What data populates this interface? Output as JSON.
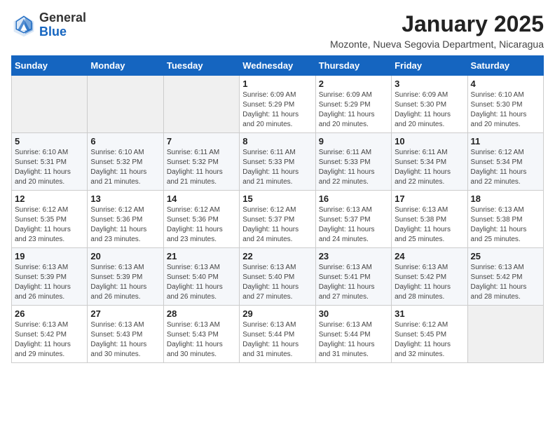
{
  "logo": {
    "general": "General",
    "blue": "Blue"
  },
  "header": {
    "title": "January 2025",
    "subtitle": "Mozonte, Nueva Segovia Department, Nicaragua"
  },
  "weekdays": [
    "Sunday",
    "Monday",
    "Tuesday",
    "Wednesday",
    "Thursday",
    "Friday",
    "Saturday"
  ],
  "weeks": [
    [
      {
        "day": "",
        "detail": ""
      },
      {
        "day": "",
        "detail": ""
      },
      {
        "day": "",
        "detail": ""
      },
      {
        "day": "1",
        "detail": "Sunrise: 6:09 AM\nSunset: 5:29 PM\nDaylight: 11 hours\nand 20 minutes."
      },
      {
        "day": "2",
        "detail": "Sunrise: 6:09 AM\nSunset: 5:29 PM\nDaylight: 11 hours\nand 20 minutes."
      },
      {
        "day": "3",
        "detail": "Sunrise: 6:09 AM\nSunset: 5:30 PM\nDaylight: 11 hours\nand 20 minutes."
      },
      {
        "day": "4",
        "detail": "Sunrise: 6:10 AM\nSunset: 5:30 PM\nDaylight: 11 hours\nand 20 minutes."
      }
    ],
    [
      {
        "day": "5",
        "detail": "Sunrise: 6:10 AM\nSunset: 5:31 PM\nDaylight: 11 hours\nand 20 minutes."
      },
      {
        "day": "6",
        "detail": "Sunrise: 6:10 AM\nSunset: 5:32 PM\nDaylight: 11 hours\nand 21 minutes."
      },
      {
        "day": "7",
        "detail": "Sunrise: 6:11 AM\nSunset: 5:32 PM\nDaylight: 11 hours\nand 21 minutes."
      },
      {
        "day": "8",
        "detail": "Sunrise: 6:11 AM\nSunset: 5:33 PM\nDaylight: 11 hours\nand 21 minutes."
      },
      {
        "day": "9",
        "detail": "Sunrise: 6:11 AM\nSunset: 5:33 PM\nDaylight: 11 hours\nand 22 minutes."
      },
      {
        "day": "10",
        "detail": "Sunrise: 6:11 AM\nSunset: 5:34 PM\nDaylight: 11 hours\nand 22 minutes."
      },
      {
        "day": "11",
        "detail": "Sunrise: 6:12 AM\nSunset: 5:34 PM\nDaylight: 11 hours\nand 22 minutes."
      }
    ],
    [
      {
        "day": "12",
        "detail": "Sunrise: 6:12 AM\nSunset: 5:35 PM\nDaylight: 11 hours\nand 23 minutes."
      },
      {
        "day": "13",
        "detail": "Sunrise: 6:12 AM\nSunset: 5:36 PM\nDaylight: 11 hours\nand 23 minutes."
      },
      {
        "day": "14",
        "detail": "Sunrise: 6:12 AM\nSunset: 5:36 PM\nDaylight: 11 hours\nand 23 minutes."
      },
      {
        "day": "15",
        "detail": "Sunrise: 6:12 AM\nSunset: 5:37 PM\nDaylight: 11 hours\nand 24 minutes."
      },
      {
        "day": "16",
        "detail": "Sunrise: 6:13 AM\nSunset: 5:37 PM\nDaylight: 11 hours\nand 24 minutes."
      },
      {
        "day": "17",
        "detail": "Sunrise: 6:13 AM\nSunset: 5:38 PM\nDaylight: 11 hours\nand 25 minutes."
      },
      {
        "day": "18",
        "detail": "Sunrise: 6:13 AM\nSunset: 5:38 PM\nDaylight: 11 hours\nand 25 minutes."
      }
    ],
    [
      {
        "day": "19",
        "detail": "Sunrise: 6:13 AM\nSunset: 5:39 PM\nDaylight: 11 hours\nand 26 minutes."
      },
      {
        "day": "20",
        "detail": "Sunrise: 6:13 AM\nSunset: 5:39 PM\nDaylight: 11 hours\nand 26 minutes."
      },
      {
        "day": "21",
        "detail": "Sunrise: 6:13 AM\nSunset: 5:40 PM\nDaylight: 11 hours\nand 26 minutes."
      },
      {
        "day": "22",
        "detail": "Sunrise: 6:13 AM\nSunset: 5:40 PM\nDaylight: 11 hours\nand 27 minutes."
      },
      {
        "day": "23",
        "detail": "Sunrise: 6:13 AM\nSunset: 5:41 PM\nDaylight: 11 hours\nand 27 minutes."
      },
      {
        "day": "24",
        "detail": "Sunrise: 6:13 AM\nSunset: 5:42 PM\nDaylight: 11 hours\nand 28 minutes."
      },
      {
        "day": "25",
        "detail": "Sunrise: 6:13 AM\nSunset: 5:42 PM\nDaylight: 11 hours\nand 28 minutes."
      }
    ],
    [
      {
        "day": "26",
        "detail": "Sunrise: 6:13 AM\nSunset: 5:42 PM\nDaylight: 11 hours\nand 29 minutes."
      },
      {
        "day": "27",
        "detail": "Sunrise: 6:13 AM\nSunset: 5:43 PM\nDaylight: 11 hours\nand 30 minutes."
      },
      {
        "day": "28",
        "detail": "Sunrise: 6:13 AM\nSunset: 5:43 PM\nDaylight: 11 hours\nand 30 minutes."
      },
      {
        "day": "29",
        "detail": "Sunrise: 6:13 AM\nSunset: 5:44 PM\nDaylight: 11 hours\nand 31 minutes."
      },
      {
        "day": "30",
        "detail": "Sunrise: 6:13 AM\nSunset: 5:44 PM\nDaylight: 11 hours\nand 31 minutes."
      },
      {
        "day": "31",
        "detail": "Sunrise: 6:12 AM\nSunset: 5:45 PM\nDaylight: 11 hours\nand 32 minutes."
      },
      {
        "day": "",
        "detail": ""
      }
    ]
  ]
}
